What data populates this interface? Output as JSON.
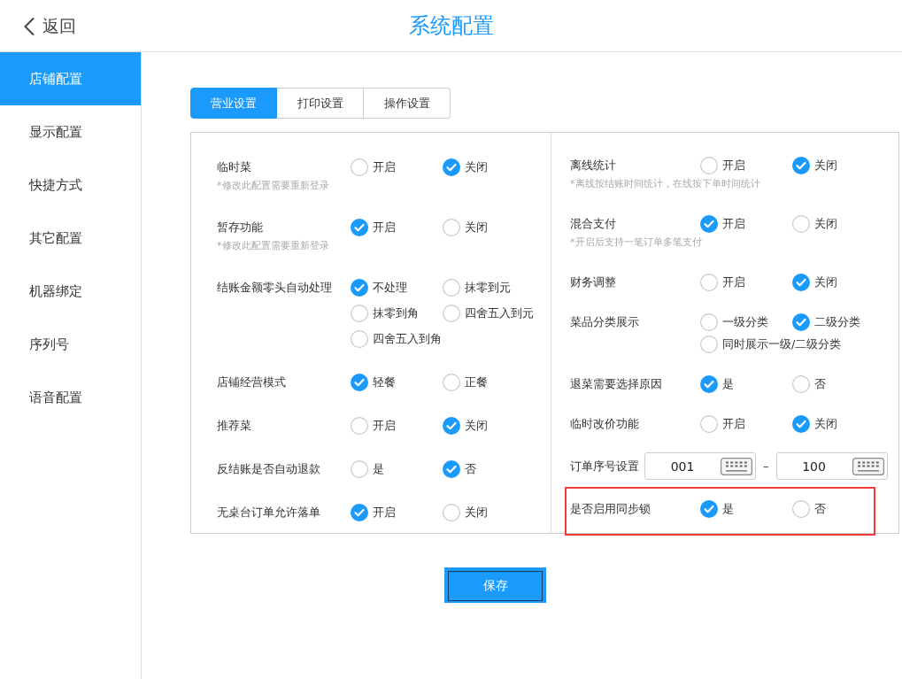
{
  "header": {
    "back": {
      "label": "返回"
    },
    "title": "系统配置"
  },
  "sidebar": {
    "items": [
      {
        "label": "店铺配置",
        "selected": true
      },
      {
        "label": "显示配置",
        "selected": false
      },
      {
        "label": "快捷方式",
        "selected": false
      },
      {
        "label": "其它配置",
        "selected": false
      },
      {
        "label": "机器绑定",
        "selected": false
      },
      {
        "label": "序列号",
        "selected": false
      },
      {
        "label": "语音配置",
        "selected": false
      }
    ]
  },
  "tabs": [
    {
      "label": "营业设置",
      "selected": true
    },
    {
      "label": "打印设置",
      "selected": false
    },
    {
      "label": "操作设置",
      "selected": false
    }
  ],
  "settings": {
    "columns": [
      {
        "rows": [
          {
            "kind": "radio",
            "label": "临时菜",
            "note": "*修改此配置需要重新登录",
            "highlighted": false,
            "options": [
              {
                "label": "开启",
                "selected": false
              },
              {
                "label": "关闭",
                "selected": true
              }
            ]
          },
          {
            "kind": "radio",
            "label": "暂存功能",
            "note": "*修改此配置需要重新登录",
            "highlighted": false,
            "options": [
              {
                "label": "开启",
                "selected": true
              },
              {
                "label": "关闭",
                "selected": false
              }
            ]
          },
          {
            "kind": "radio",
            "label": "结账金额零头自动处理",
            "highlighted": false,
            "options": [
              {
                "label": "不处理",
                "selected": true
              },
              {
                "label": "抹零到元",
                "selected": false
              },
              {
                "label": "抹零到角",
                "selected": false
              },
              {
                "label": "四舍五入到元",
                "selected": false
              },
              {
                "label": "四舍五入到角",
                "selected": false
              }
            ]
          },
          {
            "kind": "radio",
            "label": "店铺经营模式",
            "highlighted": false,
            "options": [
              {
                "label": "轻餐",
                "selected": true
              },
              {
                "label": "正餐",
                "selected": false
              }
            ]
          },
          {
            "kind": "radio",
            "label": "推荐菜",
            "highlighted": false,
            "options": [
              {
                "label": "开启",
                "selected": false
              },
              {
                "label": "关闭",
                "selected": true
              }
            ]
          },
          {
            "kind": "radio",
            "label": "反结账是否自动退款",
            "highlighted": false,
            "options": [
              {
                "label": "是",
                "selected": false
              },
              {
                "label": "否",
                "selected": true
              }
            ]
          },
          {
            "kind": "radio",
            "label": "无桌台订单允许落单",
            "highlighted": false,
            "options": [
              {
                "label": "开启",
                "selected": true
              },
              {
                "label": "关闭",
                "selected": false
              }
            ]
          }
        ]
      },
      {
        "rows": [
          {
            "kind": "radio",
            "label": "离线统计",
            "note": "*离线按结账时间统计，在线按下单时间统计",
            "highlighted": false,
            "options": [
              {
                "label": "开启",
                "selected": false
              },
              {
                "label": "关闭",
                "selected": true
              }
            ]
          },
          {
            "kind": "radio",
            "label": "混合支付",
            "note": "*开启后支持一笔订单多笔支付",
            "highlighted": false,
            "options": [
              {
                "label": "开启",
                "selected": true
              },
              {
                "label": "关闭",
                "selected": false
              }
            ]
          },
          {
            "kind": "radio",
            "label": "财务调整",
            "highlighted": false,
            "options": [
              {
                "label": "开启",
                "selected": false
              },
              {
                "label": "关闭",
                "selected": true
              }
            ]
          },
          {
            "kind": "radio",
            "label": "菜品分类展示",
            "highlighted": false,
            "options": [
              {
                "label": "一级分类",
                "selected": false
              },
              {
                "label": "二级分类",
                "selected": true
              },
              {
                "label": "同时展示一级/二级分类",
                "selected": false
              }
            ]
          },
          {
            "kind": "radio",
            "label": "退菜需要选择原因",
            "highlighted": false,
            "options": [
              {
                "label": "是",
                "selected": true
              },
              {
                "label": "否",
                "selected": false
              }
            ]
          },
          {
            "kind": "radio",
            "label": "临时改价功能",
            "highlighted": false,
            "options": [
              {
                "label": "开启",
                "selected": false
              },
              {
                "label": "关闭",
                "selected": true
              }
            ]
          },
          {
            "kind": "range",
            "label": "订单序号设置",
            "highlighted": false,
            "from": {
              "value": "001"
            },
            "separator": "–",
            "to": {
              "value": "100"
            }
          },
          {
            "kind": "radio",
            "label": "是否启用同步锁",
            "highlighted": true,
            "options": [
              {
                "label": "是",
                "selected": true
              },
              {
                "label": "否",
                "selected": false
              }
            ]
          }
        ]
      }
    ]
  },
  "save_button": {
    "label": "保存"
  }
}
